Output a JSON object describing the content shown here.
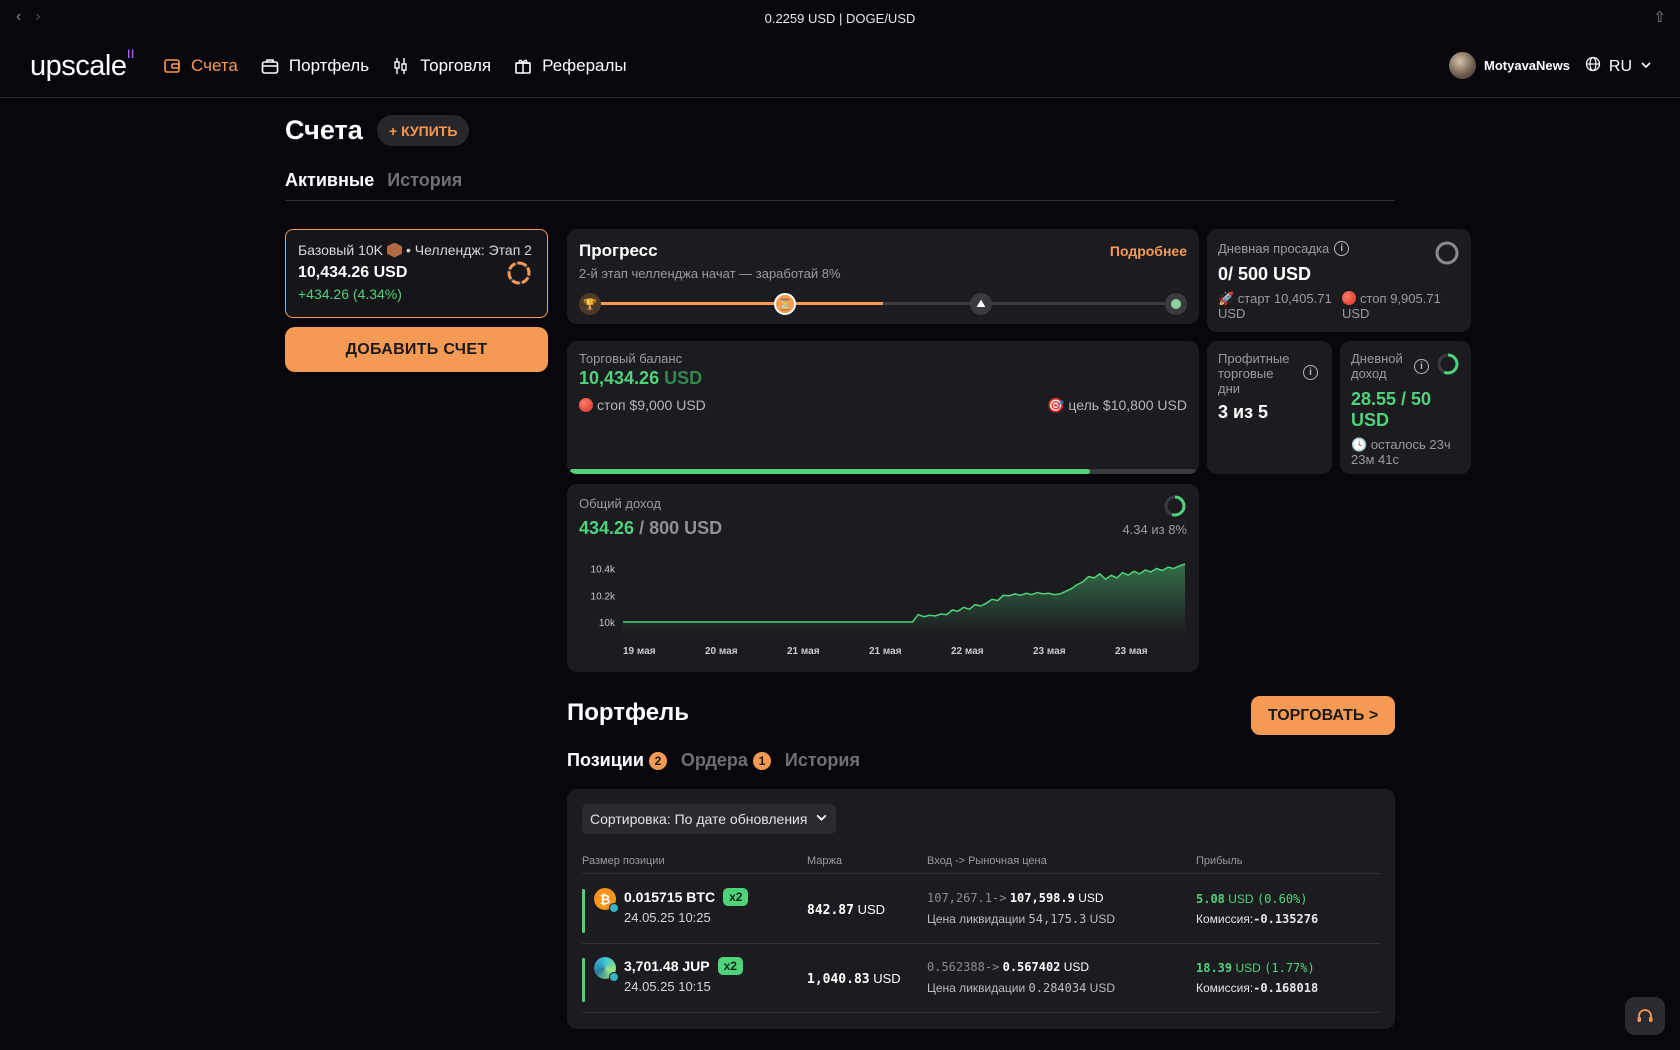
{
  "titlebar": {
    "title": "0.2259 USD | DOGE/USD"
  },
  "nav": {
    "logo": "upscale",
    "items": [
      {
        "label": "Счета",
        "icon": "wallet-icon",
        "active": true
      },
      {
        "label": "Портфель",
        "icon": "briefcase-icon",
        "active": false
      },
      {
        "label": "Торговля",
        "icon": "candles-icon",
        "active": false
      },
      {
        "label": "Рефералы",
        "icon": "gift-icon",
        "active": false
      }
    ],
    "username": "MotyavaNews",
    "language": "RU"
  },
  "accounts": {
    "title": "Счета",
    "buy_label": "+ КУПИТЬ",
    "tabs": [
      "Активные",
      "История"
    ],
    "card": {
      "plan": "Базовый 10K",
      "stage": "• Челлендж: Этап 2",
      "balance": "10,434.26 USD",
      "pnl": "+434.26 (4.34%)",
      "progress": 0.75
    },
    "add_label": "ДОБАВИТЬ СЧЕТ"
  },
  "progress": {
    "title": "Прогресс",
    "more": "Подробнее",
    "subtitle": "2-й этап челленджа начат — заработай 8%",
    "fill": 0.5
  },
  "drawdown": {
    "label": "Дневная просадка",
    "value": "0/ 500 USD",
    "start": "🚀 старт 10,405.71 USD",
    "stop": "стоп 9,905.71 USD"
  },
  "balance": {
    "label": "Торговый баланс",
    "value": "10,434.26",
    "currency": "USD",
    "stop": "стоп $9,000 USD",
    "target": "🎯 цель $10,800 USD",
    "fill": 0.83
  },
  "profit_days": {
    "label": "Профитные торговые дни",
    "value": "3 из 5"
  },
  "daily_income": {
    "label": "Дневной доход",
    "value": "28.55 / 50 USD",
    "remaining": "осталось 23ч 23м 41с"
  },
  "total_income": {
    "label": "Общий доход",
    "value": "434.26",
    "rest": "/ 800 USD",
    "pct": "4.34 из 8%"
  },
  "chart_data": {
    "type": "area",
    "x_labels": [
      "19 мая",
      "20 мая",
      "21 мая",
      "21 мая",
      "22 мая",
      "23 мая",
      "23 мая"
    ],
    "y_ticks": [
      "10.4k",
      "10.2k",
      "10k"
    ],
    "ylim": [
      10000,
      10434
    ],
    "values": [
      10000,
      10000,
      10000,
      10000,
      10000,
      10000,
      10000,
      10000,
      10000,
      10000,
      10000,
      10000,
      10000,
      10000,
      10000,
      10000,
      10000,
      10000,
      10000,
      10000,
      10000,
      10000,
      10000,
      10000,
      10000,
      10000,
      10000,
      10000,
      10000,
      10000,
      10000,
      10000,
      10000,
      10000,
      10000,
      10000,
      10000,
      10000,
      10000,
      10000,
      10000,
      10000,
      10000,
      10000,
      10000,
      10000,
      10000,
      10000,
      10000,
      10000,
      10000,
      10000,
      10055,
      10040,
      10050,
      10045,
      10060,
      10055,
      10090,
      10080,
      10110,
      10095,
      10130,
      10120,
      10140,
      10170,
      10160,
      10200,
      10195,
      10210,
      10200,
      10215,
      10205,
      10220,
      10210,
      10215,
      10205,
      10210,
      10230,
      10250,
      10280,
      10300,
      10340,
      10330,
      10360,
      10320,
      10350,
      10330,
      10370,
      10350,
      10380,
      10360,
      10390,
      10375,
      10400,
      10385,
      10410,
      10400,
      10420,
      10434
    ]
  },
  "portfolio": {
    "title": "Портфель",
    "trade_label": "ТОРГОВАТЬ >",
    "tabs": [
      {
        "label": "Позиции",
        "count": "2"
      },
      {
        "label": "Ордера",
        "count": "1"
      },
      {
        "label": "История",
        "count": ""
      }
    ],
    "sort_label": "Сортировка: По дате обновления",
    "columns": [
      "Размер позиции",
      "Маржа",
      "Вход -> Рыночная цена",
      "Прибыль"
    ],
    "rows": [
      {
        "size": "0.015715 BTC",
        "leverage": "x2",
        "date": "24.05.25 10:25",
        "margin": "842.87",
        "margin_unit": "USD",
        "entry": "107,267.1->",
        "market": "107,598.9",
        "market_unit": "USD",
        "liq_label": "Цена ликвидации",
        "liq": "54,175.3",
        "liq_unit": "USD",
        "profit": "5.08",
        "profit_unit": "USD",
        "profit_pct": "(0.60%)",
        "comm_label": "Комиссия:",
        "comm": "-0.135276",
        "coin": "btc-icon"
      },
      {
        "size": "3,701.48 JUP",
        "leverage": "x2",
        "date": "24.05.25 10:15",
        "margin": "1,040.83",
        "margin_unit": "USD",
        "entry": "0.562388->",
        "market": "0.567402",
        "market_unit": "USD",
        "liq_label": "Цена ликвидации",
        "liq": "0.284034",
        "liq_unit": "USD",
        "profit": "18.39",
        "profit_unit": "USD",
        "profit_pct": "(1.77%)",
        "comm_label": "Комиссия:",
        "comm": "-0.168018",
        "coin": "jup-icon"
      }
    ]
  },
  "colors": {
    "accent": "#f59a54",
    "green": "#4fd37a",
    "bg": "#08070d",
    "card": "#1c1c20"
  }
}
